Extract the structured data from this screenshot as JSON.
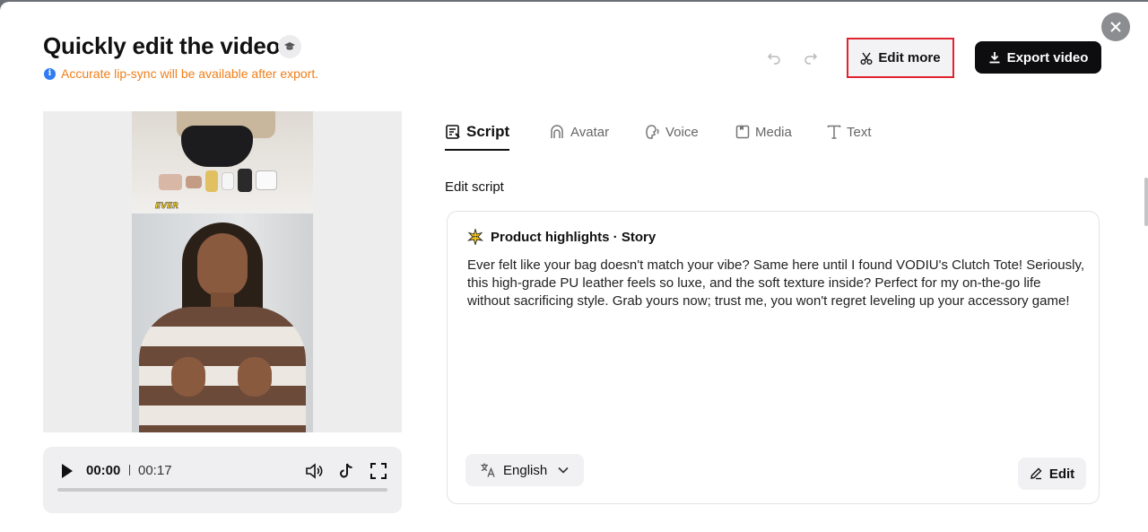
{
  "header": {
    "title": "Quickly edit the video",
    "notice": "Accurate lip-sync will be available after export.",
    "edit_more_label": "Edit more",
    "export_label": "Export video"
  },
  "video": {
    "caption": "EVER",
    "current_time": "00:00",
    "duration": "00:17",
    "progress": 0
  },
  "tabs": [
    {
      "label": "Script",
      "icon": "script-icon",
      "active": true
    },
    {
      "label": "Avatar",
      "icon": "avatar-icon",
      "active": false
    },
    {
      "label": "Voice",
      "icon": "voice-icon",
      "active": false
    },
    {
      "label": "Media",
      "icon": "media-icon",
      "active": false
    },
    {
      "label": "Text",
      "icon": "text-icon",
      "active": false
    }
  ],
  "script": {
    "section_label": "Edit script",
    "card_title": "Product highlights · Story",
    "body": "Ever felt like your bag doesn't match your vibe? Same here until I found VODIU's Clutch Tote! Seriously, this high-grade PU leather feels so luxe, and the soft texture inside? Perfect for my on-the-go life without sacrificing style. Grab yours now; trust me, you won't regret leveling up your accessory game!",
    "language": "English",
    "edit_label": "Edit"
  },
  "colors": {
    "notice": "#f07f1a",
    "info": "#2f7cf6",
    "highlight_border": "#e0242f",
    "primary_button": "#0d0d0f"
  }
}
